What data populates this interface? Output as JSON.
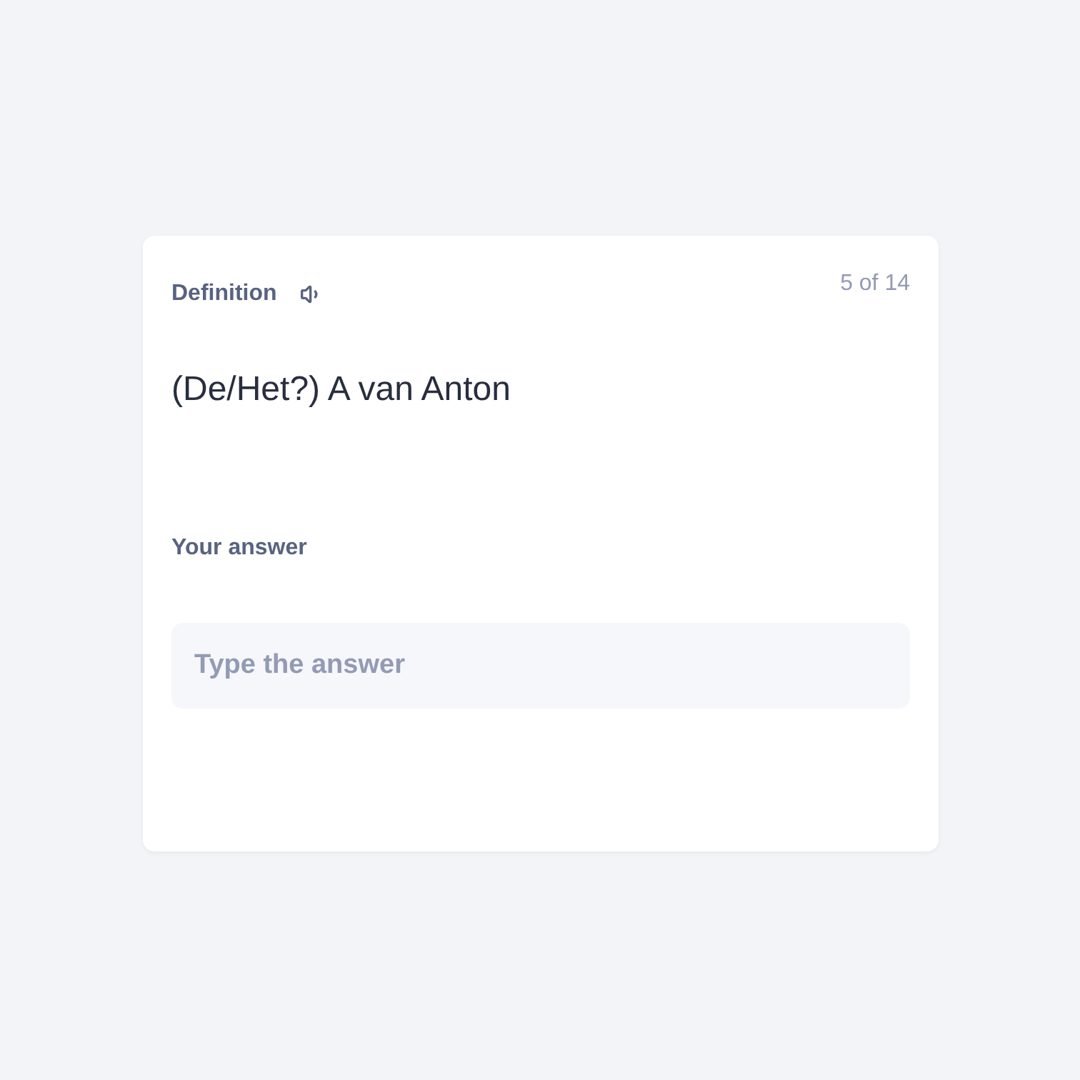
{
  "card": {
    "label": "Definition",
    "counter": "5 of 14",
    "prompt": "(De/Het?) A van Anton",
    "answer_label": "Your answer",
    "answer_field": {
      "placeholder": "Type the answer"
    }
  }
}
